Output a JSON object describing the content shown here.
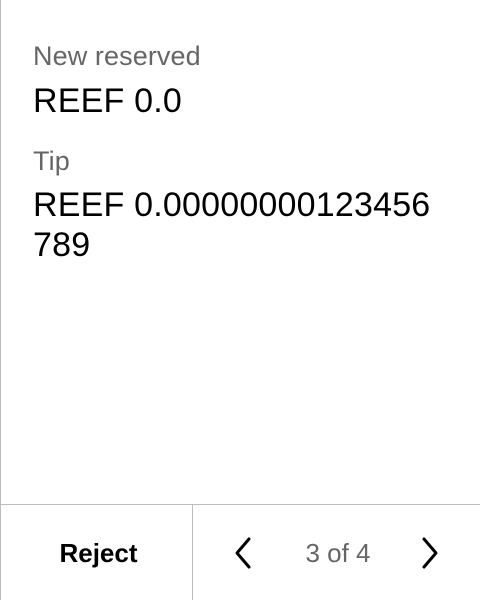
{
  "fields": {
    "reserved": {
      "label": "New reserved",
      "value": "REEF 0.0"
    },
    "tip": {
      "label": "Tip",
      "value": "REEF 0.00000000123456789"
    }
  },
  "footer": {
    "reject_label": "Reject",
    "page_indicator": "3 of 4",
    "prev_icon": "chevron-left-icon",
    "next_icon": "chevron-right-icon"
  }
}
